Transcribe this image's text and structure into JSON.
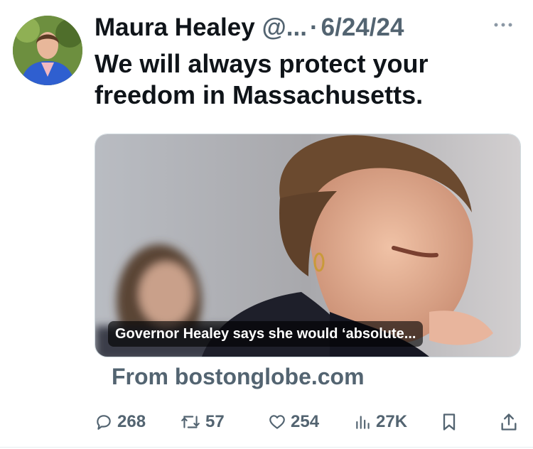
{
  "author": {
    "name": "Maura Healey",
    "handle": "@...",
    "separator": "·",
    "date": "6/24/24"
  },
  "tweet": {
    "text": "We will always protect your freedom in Massachusetts."
  },
  "link_card": {
    "caption": "Governor Healey says she would ‘absolute...",
    "source": "From bostonglobe.com"
  },
  "actions": {
    "replies": "268",
    "reposts": "57",
    "likes": "254",
    "views": "27K"
  },
  "colors": {
    "text": "#0f1419",
    "secondary": "#536471"
  },
  "icons": [
    "more-icon",
    "reply-icon",
    "repost-icon",
    "like-icon",
    "views-icon",
    "bookmark-icon",
    "share-icon"
  ]
}
